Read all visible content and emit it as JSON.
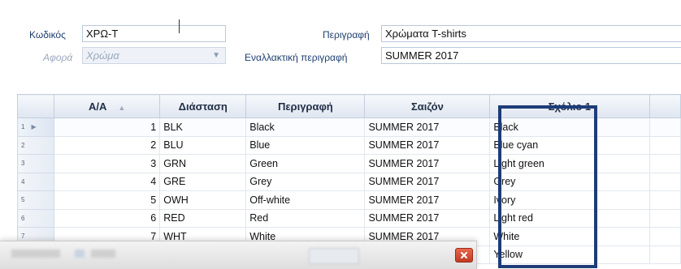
{
  "form": {
    "code_label": "Κωδικός",
    "code_value": "ΧΡΩ-Τ",
    "about_label": "Αφορά",
    "about_value": "Χρώμα",
    "desc_label": "Περιγραφή",
    "desc_value": "Χρώματα T-shirts",
    "alt_desc_label": "Εναλλακτική περιγραφή",
    "alt_desc_value": "SUMMER 2017"
  },
  "grid": {
    "columns": [
      "Α/Α",
      "Διάσταση",
      "Περιγραφή",
      "Σαιζόν",
      "Σχόλιο 1"
    ],
    "rows": [
      {
        "rh": "1",
        "aa": "1",
        "dim": "BLK",
        "desc": "Black",
        "season": "SUMMER 2017",
        "comment": "Black"
      },
      {
        "rh": "2",
        "aa": "2",
        "dim": "BLU",
        "desc": "Blue",
        "season": "SUMMER 2017",
        "comment": "Blue cyan"
      },
      {
        "rh": "3",
        "aa": "3",
        "dim": "GRN",
        "desc": "Green",
        "season": "SUMMER 2017",
        "comment": "Light green"
      },
      {
        "rh": "4",
        "aa": "4",
        "dim": "GRE",
        "desc": "Grey",
        "season": "SUMMER 2017",
        "comment": "Grey"
      },
      {
        "rh": "5",
        "aa": "5",
        "dim": "OWH",
        "desc": "Off-white",
        "season": "SUMMER 2017",
        "comment": "Ivory"
      },
      {
        "rh": "6",
        "aa": "6",
        "dim": "RED",
        "desc": "Red",
        "season": "SUMMER 2017",
        "comment": "Light red"
      },
      {
        "rh": "7",
        "aa": "7",
        "dim": "WHT",
        "desc": "White",
        "season": "SUMMER 2017",
        "comment": "White"
      },
      {
        "rh": "",
        "aa": "",
        "dim": "",
        "desc": "",
        "season": "",
        "comment": "Yellow"
      }
    ]
  },
  "colors": {
    "highlight_border": "#1d3c78",
    "label_text": "#1f3f6f",
    "close_button": "#c23a24"
  },
  "icons": {
    "row_pointer": "triangle-right-icon",
    "sort": "sort-indicator-icon",
    "dropdown": "chevron-down-icon",
    "close": "close-icon"
  }
}
